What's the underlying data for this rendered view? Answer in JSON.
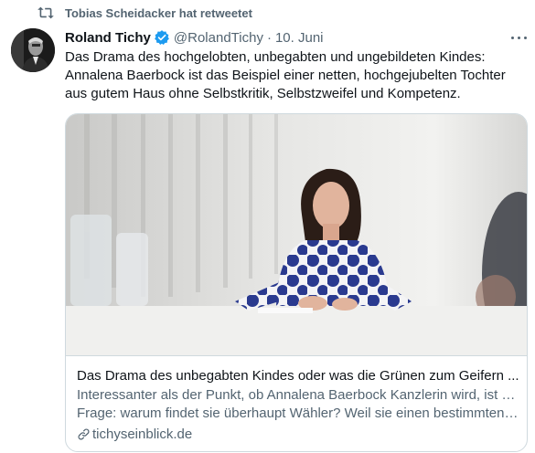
{
  "retweet": {
    "label": "Tobias Scheidacker hat retweetet",
    "icon": "retweet-icon"
  },
  "tweet": {
    "author_name": "Roland Tichy",
    "verified": true,
    "handle": "@RolandTichy",
    "separator": "·",
    "date": "10. Juni",
    "text": "Das Drama des hochgelobten, unbegabten und ungebildeten Kindes: Annalena Baerbock ist das Beispiel einer netten, hochgejubelten Tochter aus gutem Haus ohne Selbstkritik, Selbstzweifel und Kompetenz."
  },
  "card": {
    "title": "Das Drama des unbegabten Kindes oder was die Grünen zum Geifern ...",
    "description_line1": "Interessanter als der Punkt, ob Annalena Baerbock Kanzlerin wird, ist die",
    "description_line2": "Frage: warum findet sie überhaupt Wähler? Weil sie einen bestimmten ...",
    "domain": "tichyseinblick.de"
  },
  "colors": {
    "text_primary": "#0f1419",
    "text_secondary": "#536471",
    "verified_blue": "#1d9bf0",
    "border": "#cfd9de",
    "dress_blue": "#2a3a8f"
  }
}
